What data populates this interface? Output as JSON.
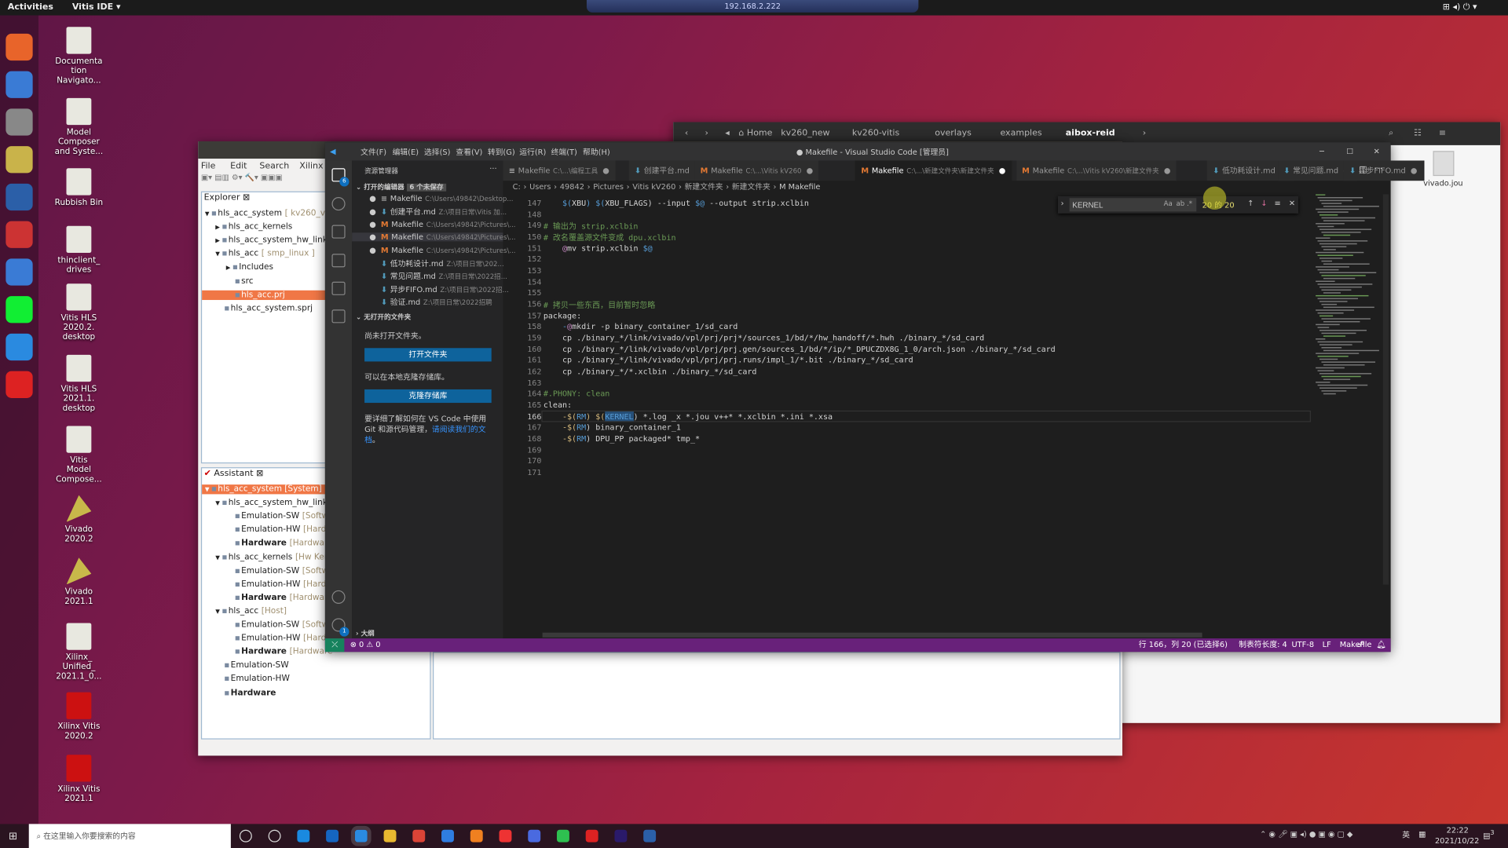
{
  "topbar": {
    "activities": "Activities",
    "app": "Vitis IDE ▾",
    "remote_title": "192.168.2.222"
  },
  "dock": {
    "icons": [
      "firefox-icon",
      "thunderbird-icon",
      "files-icon",
      "rhythmbox-icon",
      "writer-icon",
      "software-icon",
      "help-icon",
      "pycharm-icon",
      "vscode-icon",
      "vitis-icon"
    ]
  },
  "desktop": {
    "icons": [
      {
        "label": "Documenta\ntion\nNavigato...",
        "icon": "document-icon"
      },
      {
        "label": "Model\nComposer\nand Syste...",
        "icon": "model-composer-icon"
      },
      {
        "label": "Rubbish Bin",
        "icon": "trash-icon"
      },
      {
        "label": "thinclient_\ndrives",
        "icon": "drive-icon"
      },
      {
        "label": "Vitis HLS\n2020.2.\ndesktop",
        "icon": "document-icon"
      },
      {
        "label": "Vitis HLS\n2021.1.\ndesktop",
        "icon": "document-icon"
      },
      {
        "label": "Vitis\nModel\nCompose...",
        "icon": "document-icon"
      },
      {
        "label": "Vivado\n2020.2",
        "icon": "vivado-icon"
      },
      {
        "label": "Vivado\n2021.1",
        "icon": "vivado-icon"
      },
      {
        "label": "Xilinx_\nUnified_\n2021.1_0...",
        "icon": "archive-icon"
      },
      {
        "label": "Xilinx Vitis\n2020.2",
        "icon": "vitis-icon"
      },
      {
        "label": "Xilinx Vitis\n2021.1",
        "icon": "vitis-icon"
      }
    ]
  },
  "filemanager": {
    "path": [
      "Home",
      "kv260_new",
      "kv260-vitis",
      "overlays",
      "examples",
      "aibox-reid"
    ],
    "file": "vivado.jou"
  },
  "vitis": {
    "menu": [
      "File",
      "Edit",
      "Search",
      "Xilinx",
      "Pro"
    ],
    "explorer_tab": "Explorer",
    "explorer": [
      {
        "t": "hls_acc_system",
        "g": "[ kv260_vc",
        "d": 0,
        "tw": "▼"
      },
      {
        "t": "hls_acc_kernels",
        "g": "",
        "d": 1,
        "tw": "▶"
      },
      {
        "t": "hls_acc_system_hw_link",
        "g": "",
        "d": 1,
        "tw": "▶"
      },
      {
        "t": "hls_acc",
        "g": "[ smp_linux ]",
        "d": 1,
        "tw": "▼"
      },
      {
        "t": "Includes",
        "g": "",
        "d": 2,
        "tw": "▶"
      },
      {
        "t": "src",
        "g": "",
        "d": 2,
        "tw": ""
      },
      {
        "t": "hls_acc.prj",
        "g": "",
        "d": 2,
        "tw": "",
        "sel": true
      },
      {
        "t": "hls_acc_system.sprj",
        "g": "",
        "d": 1,
        "tw": ""
      }
    ],
    "assistant_tab": "Assistant",
    "assistant": [
      {
        "t": "hls_acc_system [System]",
        "g": "",
        "d": 0,
        "tw": "▼",
        "sel": true
      },
      {
        "t": "hls_acc_system_hw_link",
        "g": "",
        "d": 1,
        "tw": "▼"
      },
      {
        "t": "Emulation-SW",
        "g": "[Softw",
        "d": 2,
        "tw": ""
      },
      {
        "t": "Emulation-HW",
        "g": "[Hardw",
        "d": 2,
        "tw": ""
      },
      {
        "t": "Hardware",
        "g": "[Hardware",
        "d": 2,
        "tw": "",
        "b": true
      },
      {
        "t": "hls_acc_kernels",
        "g": "[Hw Ker",
        "d": 1,
        "tw": "▼"
      },
      {
        "t": "Emulation-SW",
        "g": "[Softw",
        "d": 2,
        "tw": ""
      },
      {
        "t": "Emulation-HW",
        "g": "[Hardw",
        "d": 2,
        "tw": ""
      },
      {
        "t": "Hardware",
        "g": "[Hardware",
        "d": 2,
        "tw": "",
        "b": true
      },
      {
        "t": "hls_acc",
        "g": "[Host]",
        "d": 1,
        "tw": "▼"
      },
      {
        "t": "Emulation-SW",
        "g": "[Softw",
        "d": 2,
        "tw": ""
      },
      {
        "t": "Emulation-HW",
        "g": "[Hardw",
        "d": 2,
        "tw": ""
      },
      {
        "t": "Hardware",
        "g": "[Hardware",
        "d": 2,
        "tw": "",
        "b": true
      },
      {
        "t": "Emulation-SW",
        "g": "",
        "d": 1,
        "tw": ""
      },
      {
        "t": "Emulation-HW",
        "g": "",
        "d": 1,
        "tw": ""
      },
      {
        "t": "Hardware",
        "g": "",
        "d": 1,
        "tw": "",
        "b": true
      }
    ]
  },
  "vscode": {
    "menu": [
      "文件(F)",
      "编辑(E)",
      "选择(S)",
      "查看(V)",
      "转到(G)",
      "运行(R)",
      "终端(T)",
      "帮助(H)"
    ],
    "title": "● Makefile - Visual Studio Code [管理员]",
    "explorer_badge": "6",
    "settings_badge": "1",
    "sidebar": {
      "header": "资源管理器",
      "open_editors": "打开的编辑器",
      "unsaved": "6 个未保存",
      "files": [
        {
          "n": "Makefile",
          "p": "C:\\Users\\49842\\Desktop...",
          "dot": true,
          "i": "≡"
        },
        {
          "n": "创建平台.md",
          "p": "Z:\\项目日常\\Vitis 加...",
          "dot": true,
          "i": "md"
        },
        {
          "n": "Makefile",
          "p": "C:\\Users\\49842\\Pictures\\...",
          "dot": true,
          "i": "M"
        },
        {
          "n": "Makefile",
          "p": "C:\\Users\\49842\\Pictures\\...",
          "dot": true,
          "i": "M"
        },
        {
          "n": "Makefile",
          "p": "C:\\Users\\49842\\Pictures\\...",
          "dot": true,
          "i": "M"
        },
        {
          "n": "低功耗设计.md",
          "p": "Z:\\项目日常\\202...",
          "dot": false,
          "i": "md"
        },
        {
          "n": "常见问题.md",
          "p": "Z:\\项目日常\\2022招...",
          "dot": false,
          "i": "md"
        },
        {
          "n": "异步FIFO.md",
          "p": "Z:\\项目日常\\2022招...",
          "dot": false,
          "i": "md"
        },
        {
          "n": "验证.md",
          "p": "Z:\\项目日常\\2022招聘",
          "dot": false,
          "i": "md"
        }
      ],
      "no_folder": "无打开的文件夹",
      "no_folder_msg": "尚未打开文件夹。",
      "open_folder": "打开文件夹",
      "clone_msg": "可以在本地克隆存储库。",
      "clone": "克隆存储库",
      "git_msg": "要详细了解如何在 VS Code 中使用 Git 和源代码管理，",
      "git_link": "请阅读我们的文档",
      "git_end": "。",
      "outline": "大纲"
    },
    "tabs": [
      {
        "n": "Makefile",
        "p": "C:\\...\\编程工具",
        "i": "≡"
      },
      {
        "n": "创建平台.md",
        "p": "",
        "i": "md"
      },
      {
        "n": "Makefile",
        "p": "C:\\...\\Vitis kV260",
        "i": "M"
      },
      {
        "n": "Makefile",
        "p": "C:\\...\\新建文件夹\\新建文件夹",
        "i": "M",
        "active": true
      },
      {
        "n": "Makefile",
        "p": "C:\\...\\Vitis kV260\\新建文件夹",
        "i": "M"
      },
      {
        "n": "低功耗设计.md",
        "p": "",
        "i": "md"
      },
      {
        "n": "常见问题.md",
        "p": "",
        "i": "md"
      },
      {
        "n": "异步FIFO.md",
        "p": "",
        "i": "md"
      }
    ],
    "breadcrumb": [
      "C:",
      "Users",
      "49842",
      "Pictures",
      "Vitis kV260",
      "新建文件夹",
      "新建文件夹",
      "Makefile"
    ],
    "find": {
      "value": "KERNEL",
      "result": "20 的 20",
      "opts": [
        "Aa",
        "ab",
        ".*"
      ]
    },
    "code": [
      [
        147,
        [
          [
            "\t$(",
            "v"
          ],
          [
            "XBU",
            ""
          ],
          [
            ") $(",
            "v"
          ],
          [
            "XBU_FLAGS",
            ""
          ],
          [
            ") --input ",
            ""
          ],
          [
            "$@",
            "v"
          ],
          [
            " --output strip.xclbin",
            ""
          ]
        ]
      ],
      [
        148,
        []
      ],
      [
        149,
        [
          [
            "# 输出为 strip.xclbin",
            "c"
          ]
        ]
      ],
      [
        150,
        [
          [
            "# 改名覆盖源文件变成 dpu.xclbin",
            "c"
          ]
        ]
      ],
      [
        151,
        [
          [
            "\t",
            ""
          ],
          [
            "@",
            "p"
          ],
          [
            "mv strip.xclbin ",
            ""
          ],
          [
            "$@",
            "v"
          ]
        ]
      ],
      [
        152,
        []
      ],
      [
        153,
        []
      ],
      [
        154,
        []
      ],
      [
        155,
        []
      ],
      [
        156,
        [
          [
            "# 拷贝一些东西，目前暂时忽略",
            "c"
          ]
        ]
      ],
      [
        157,
        [
          [
            "package:",
            ""
          ]
        ]
      ],
      [
        158,
        [
          [
            "\t-",
            "v"
          ],
          [
            "@",
            "p"
          ],
          [
            "mkdir -p binary_container_1/sd_card",
            ""
          ]
        ]
      ],
      [
        159,
        [
          [
            "\tcp ./binary_*/link/vivado/vpl/prj/prj*/sources_1/bd/*/hw_handoff/*.hwh ./binary_*/sd_card",
            ""
          ]
        ]
      ],
      [
        160,
        [
          [
            "\tcp ./binary_*/link/vivado/vpl/prj/prj.gen/sources_1/bd/*/ip/*_DPUCZDX8G_1_0/arch.json ./binary_*/sd_card",
            ""
          ]
        ]
      ],
      [
        161,
        [
          [
            "\tcp ./binary_*/link/vivado/vpl/prj/prj.runs/impl_1/*.bit ./binary_*/sd_card",
            ""
          ]
        ]
      ],
      [
        162,
        [
          [
            "\tcp ./binary_*/*.xclbin ./binary_*/sd_card",
            ""
          ]
        ]
      ],
      [
        163,
        []
      ],
      [
        164,
        [
          [
            "#.PHONY: clean",
            "c"
          ]
        ]
      ],
      [
        165,
        [
          [
            "clean:",
            ""
          ]
        ]
      ],
      [
        166,
        [
          [
            "\t-$(",
            "y"
          ],
          [
            "RM",
            "v"
          ],
          [
            ") $(",
            "y"
          ],
          [
            "KERNEL",
            "v"
          ],
          [
            ") *.log _x *.jou v++* *.xclbin *.ini *.xsa",
            ""
          ]
        ]
      ],
      [
        167,
        [
          [
            "\t-$(",
            "y"
          ],
          [
            "RM",
            "v"
          ],
          [
            ") binary_container_1",
            ""
          ]
        ]
      ],
      [
        168,
        [
          [
            "\t-$(",
            "y"
          ],
          [
            "RM",
            "v"
          ],
          [
            ") DPU_PP packaged* tmp_*",
            ""
          ]
        ]
      ],
      [
        169,
        []
      ],
      [
        170,
        []
      ],
      [
        171,
        []
      ]
    ],
    "status": {
      "errors": "0",
      "warnings": "0",
      "position": "行 166，列 20 (已选择6)",
      "tab": "制表符长度: 4",
      "encoding": "UTF-8",
      "eol": "LF",
      "lang": "Makefile"
    }
  },
  "taskbar": {
    "search_placeholder": "在这里输入你要搜索的内容",
    "time": "22:22",
    "date": "2021/10/22",
    "ime": "英",
    "notifications": "3",
    "apps": [
      "cortana-icon",
      "task-view-icon",
      "qq-browser-icon",
      "outlook-icon",
      "vscode-icon",
      "explorer-icon",
      "chrome-icon",
      "app-icon",
      "sublime-icon",
      "netease-icon",
      "remote-desktop-icon",
      "wechat-icon",
      "record-icon",
      "premiere-icon",
      "visio-icon"
    ]
  },
  "colors": {
    "accent": "#68217a",
    "selection": "#f07746",
    "button": "#0e639c"
  }
}
